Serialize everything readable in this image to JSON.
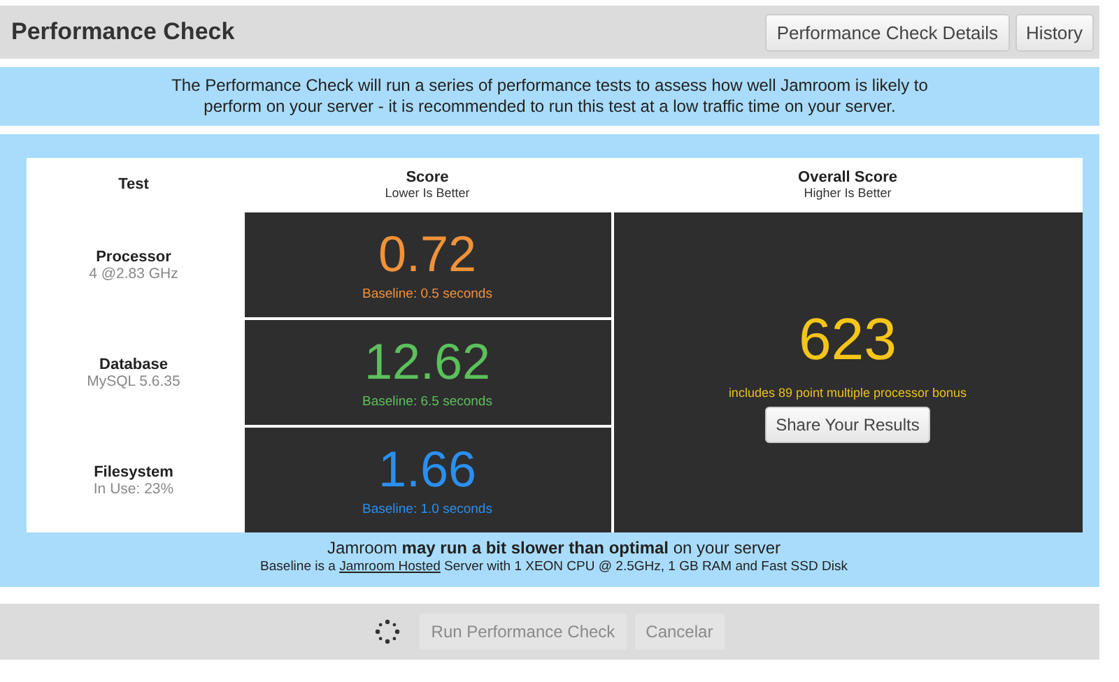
{
  "header": {
    "title": "Performance Check",
    "buttons": [
      "Performance Check Details",
      "History"
    ]
  },
  "intro": "The Performance Check will run a series of performance tests to assess how well Jamroom is likely to perform on your server - it is recommended to run this test at a low traffic time on your server.",
  "table": {
    "columns": [
      {
        "title": "Test"
      },
      {
        "title": "Score",
        "subtitle": "Lower Is Better"
      },
      {
        "title": "Overall Score",
        "subtitle": "Higher Is Better"
      }
    ],
    "rows": [
      {
        "name": "Processor",
        "detail": "4 @2.83 GHz",
        "score": "0.72",
        "baseline": "Baseline: 0.5 seconds",
        "color": "#f0923a"
      },
      {
        "name": "Database",
        "detail": "MySQL 5.6.35",
        "score": "12.62",
        "baseline": "Baseline: 6.5 seconds",
        "color": "#5cc05c"
      },
      {
        "name": "Filesystem",
        "detail": "In Use: 23%",
        "score": "1.66",
        "baseline": "Baseline: 1.0 seconds",
        "color": "#2a8ff0"
      }
    ],
    "overall": {
      "score": "623",
      "note": "includes 89 point multiple processor bonus",
      "button": "Share Your Results"
    }
  },
  "verdict": "Jamroom **may run a bit slower than optimal** on your server",
  "baseline_note": {
    "before": "Baseline is a",
    "link": "Jamroom Hosted",
    "after": "Server with 1 XEON CPU @ 2.5GHz, 1 GB RAM and Fast SSD Disk"
  },
  "footer": {
    "loading": true,
    "buttons": [
      {
        "label": "Run Performance Check",
        "disabled": true
      },
      {
        "label": "Cancelar",
        "disabled": true
      }
    ]
  }
}
